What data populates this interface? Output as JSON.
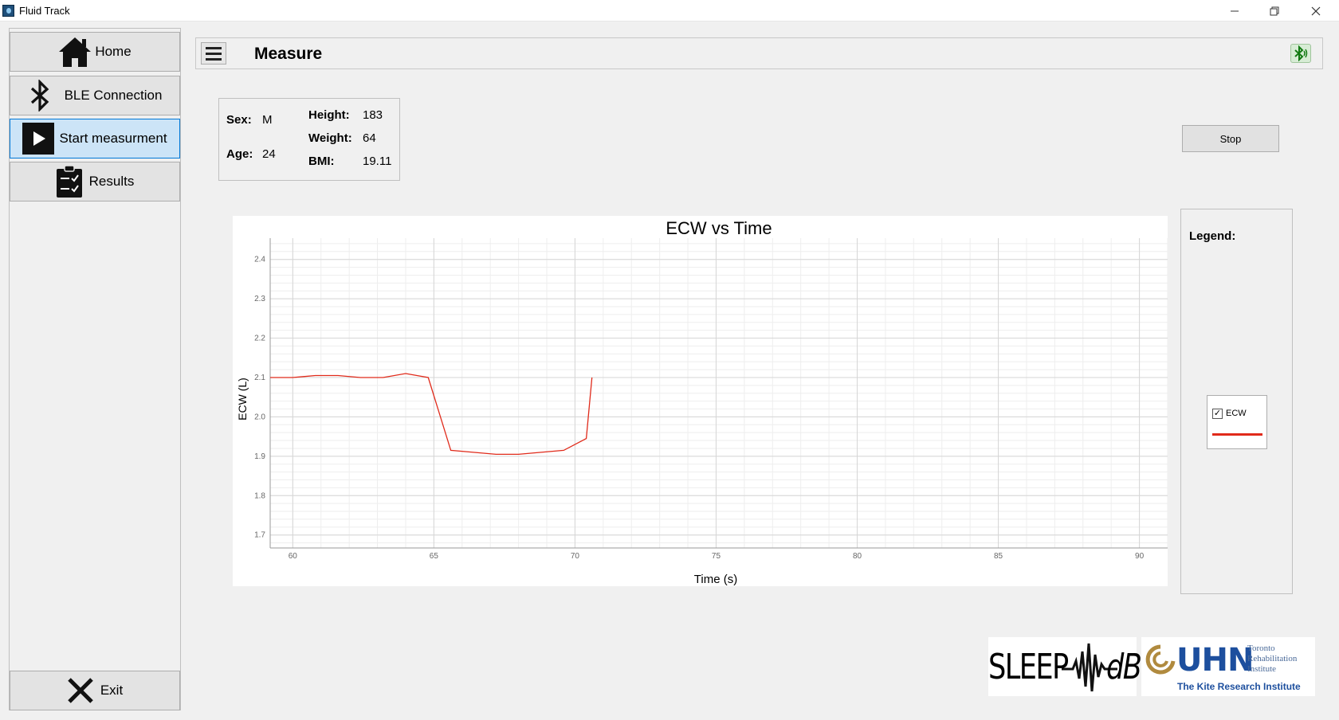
{
  "window": {
    "title": "Fluid Track"
  },
  "sidebar": {
    "items": [
      {
        "label": "Home",
        "icon": "home-icon"
      },
      {
        "label": "BLE Connection",
        "icon": "bluetooth-icon"
      },
      {
        "label": "Start measurment",
        "icon": "play-icon",
        "active": true
      },
      {
        "label": "Results",
        "icon": "clipboard-icon"
      }
    ],
    "exit": {
      "label": "Exit",
      "icon": "close-x-icon"
    }
  },
  "header": {
    "title": "Measure",
    "status_icon": "bluetooth-connected-icon"
  },
  "patient": {
    "sex_label": "Sex:",
    "sex": "M",
    "age_label": "Age:",
    "age": "24",
    "height_label": "Height:",
    "height": "183",
    "weight_label": "Weight:",
    "weight": "64",
    "bmi_label": "BMI:",
    "bmi": "19.11"
  },
  "controls": {
    "stop_label": "Stop"
  },
  "legend": {
    "title": "Legend:",
    "series_name": "ECW",
    "checked": true,
    "color": "#e02a1a"
  },
  "logos": {
    "sleep_left": "SLEEP",
    "sleep_right": "dB",
    "uhn": "UHN",
    "uhn_line1": "Toronto",
    "uhn_line2": "Rehabilitation",
    "uhn_line3": "Institute",
    "uhn_sub": "The Kite Research Institute"
  },
  "chart_data": {
    "type": "line",
    "title": "ECW vs Time",
    "xlabel": "Time (s)",
    "ylabel": "ECW (L)",
    "xlim": [
      59.2,
      91
    ],
    "ylim": [
      1.667,
      2.454
    ],
    "xticks": [
      60,
      65,
      70,
      75,
      80,
      85,
      90
    ],
    "yticks": [
      1.7,
      1.8,
      1.9,
      2.0,
      2.1,
      2.2,
      2.3,
      2.4
    ],
    "grid": true,
    "color": "#e02a1a",
    "series": [
      {
        "name": "ECW",
        "x": [
          59.2,
          60.0,
          60.8,
          61.6,
          62.4,
          63.2,
          64.0,
          64.4,
          64.8,
          65.6,
          66.4,
          67.2,
          68.0,
          68.8,
          69.6,
          70.4,
          70.6
        ],
        "y": [
          2.1,
          2.1,
          2.105,
          2.105,
          2.1,
          2.1,
          2.11,
          2.105,
          2.1,
          1.915,
          1.91,
          1.905,
          1.905,
          1.91,
          1.915,
          1.945,
          2.1
        ]
      }
    ]
  }
}
